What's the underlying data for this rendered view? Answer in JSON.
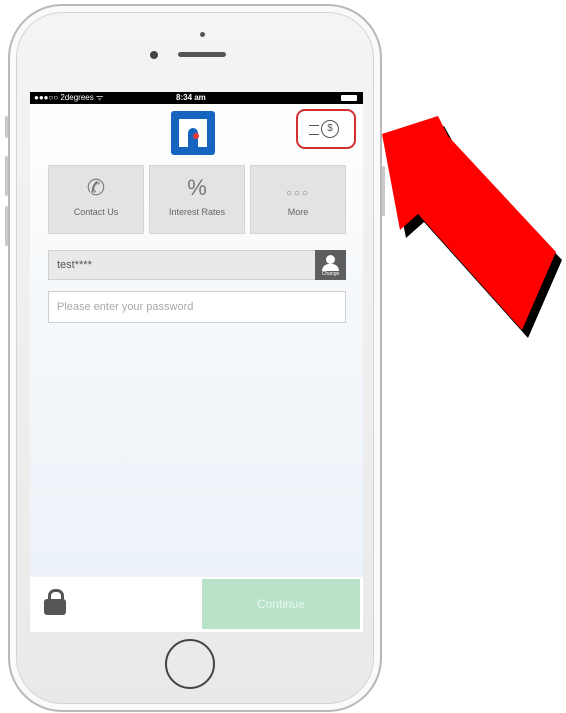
{
  "status_bar": {
    "carrier": "●●●○○ 2degrees ᯤ",
    "time": "8:34 am"
  },
  "header": {
    "logo_icon": "n-logo",
    "currency_icon": "currency-exchange-icon",
    "highlight_color": "#d32f2f"
  },
  "tiles": [
    {
      "label": "Contact Us",
      "icon": "phone-icon",
      "glyph": "✆"
    },
    {
      "label": "Interest Rates",
      "icon": "percent-icon",
      "glyph": "%"
    },
    {
      "label": "More",
      "icon": "more-dots-icon",
      "glyph": "○○○"
    }
  ],
  "login": {
    "username_value": "test****",
    "change_label": "Change",
    "password_placeholder": "Please enter your password"
  },
  "footer": {
    "continue_label": "Continue",
    "continue_color": "#b8e3c8"
  },
  "annotation": {
    "arrow_color": "#ff0000"
  }
}
